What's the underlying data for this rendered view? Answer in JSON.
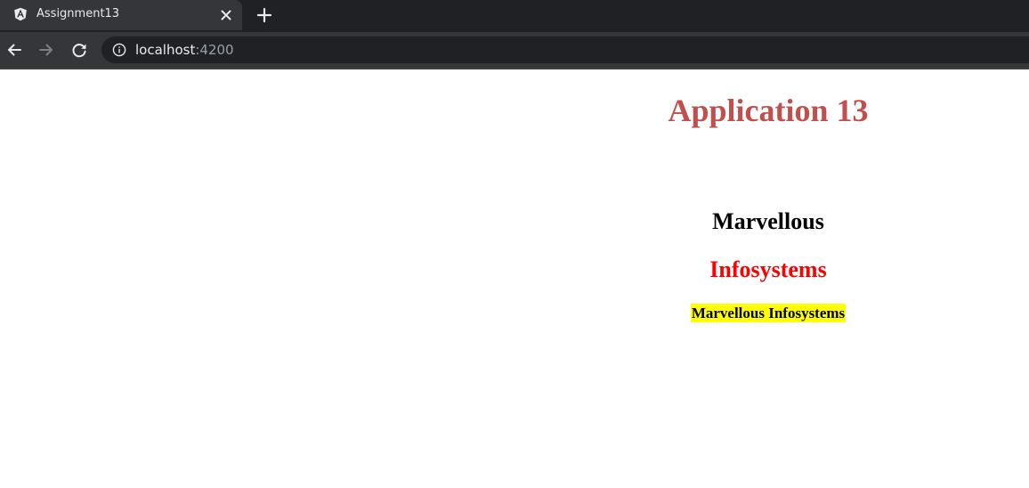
{
  "browser": {
    "tab": {
      "title": "Assignment13",
      "favicon": "angular-icon"
    },
    "address_bar": {
      "host": "localhost",
      "port": ":4200"
    }
  },
  "page": {
    "title": "Application 13",
    "heading_black": "Marvellous",
    "heading_red": "Infosystems",
    "highlighted_text": "Marvellous Infosystems"
  },
  "colors": {
    "title": "#c0504d",
    "red_heading": "#ff0000",
    "highlight": "#ffff00"
  }
}
